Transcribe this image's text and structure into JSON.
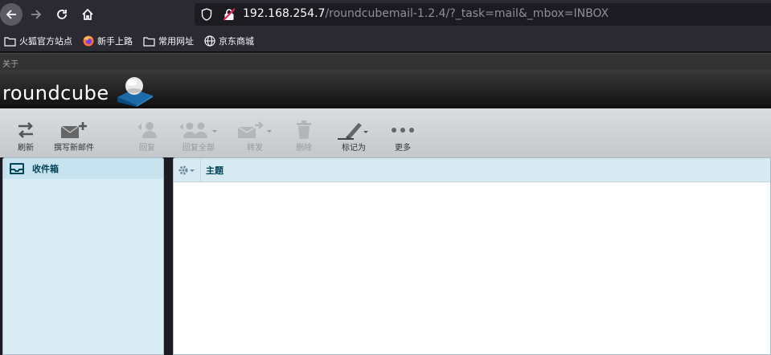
{
  "browser": {
    "url_host": "192.168.254.7",
    "url_path": "/roundcubemail-1.2.4/?_task=mail&_mbox=INBOX"
  },
  "bookmarks": [
    {
      "label": "火狐官方站点",
      "icon": "folder-icon"
    },
    {
      "label": "新手上路",
      "icon": "firefox-icon"
    },
    {
      "label": "常用网址",
      "icon": "folder-icon"
    },
    {
      "label": "京东商城",
      "icon": "globe-icon"
    }
  ],
  "topline": {
    "about": "关于"
  },
  "header": {
    "logo": "roundcube"
  },
  "toolbar": {
    "refresh": "刷新",
    "compose": "撰写新邮件",
    "reply": "回复",
    "reply_all": "回复全部",
    "forward": "转发",
    "delete": "删除",
    "mark": "标记为",
    "more": "更多"
  },
  "folders": {
    "inbox": "收件箱"
  },
  "messagelist": {
    "subject_header": "主题"
  },
  "colors": {
    "accent": "#004458",
    "panel": "#daecf4",
    "toolbar": "#d0d4d7"
  }
}
